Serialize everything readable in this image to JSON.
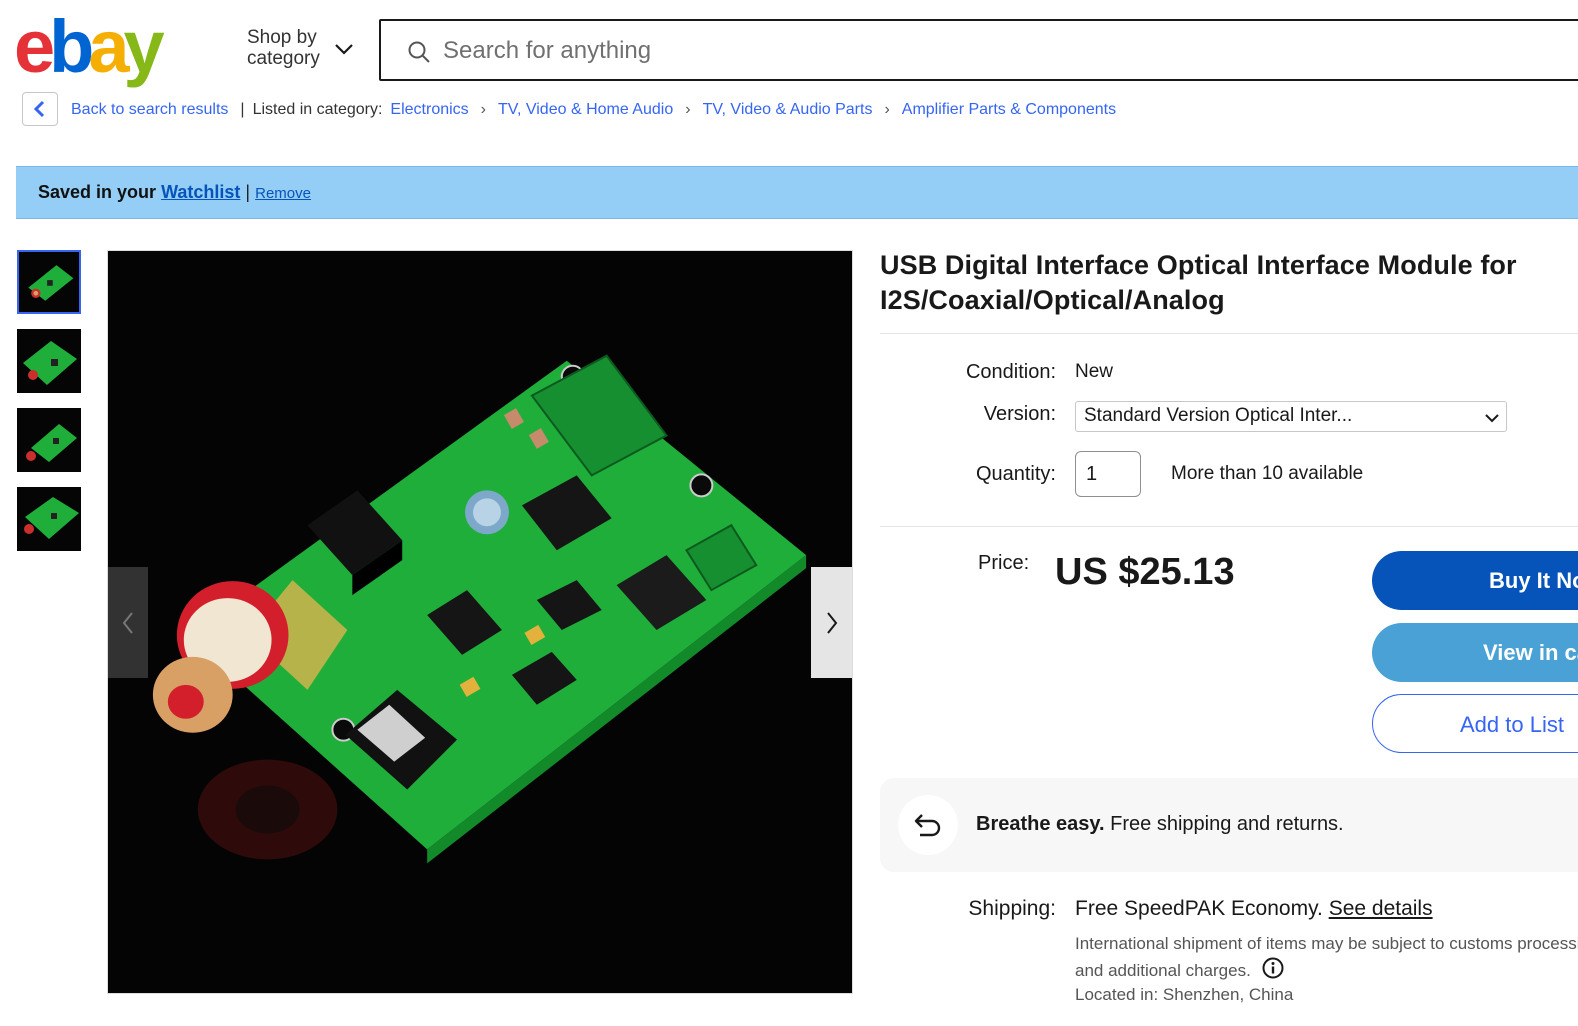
{
  "header": {
    "logo_text": "ebay",
    "shop_by_line1": "Shop by",
    "shop_by_line2": "category",
    "search_placeholder": "Search for anything"
  },
  "breadcrumb": {
    "back_label": "Back to search results",
    "listed_label": "Listed in category:",
    "items": [
      "Electronics",
      "TV, Video & Home Audio",
      "TV, Video & Audio Parts",
      "Amplifier Parts & Components"
    ]
  },
  "watchlist_banner": {
    "prefix": "Saved in your",
    "watchlist_link": "Watchlist",
    "separator": "|",
    "remove_link": "Remove"
  },
  "gallery": {
    "thumbnail_count": 4,
    "selected_index": 0
  },
  "product": {
    "title": "USB Digital Interface Optical Interface Module for I2S/Coaxial/Optical/Analog",
    "condition_label": "Condition:",
    "condition_value": "New",
    "version_label": "Version:",
    "version_value": "Standard Version Optical Inter...",
    "quantity_label": "Quantity:",
    "quantity_value": "1",
    "availability": "More than 10 available",
    "price_label": "Price:",
    "price_value": "US $25.13"
  },
  "actions": {
    "buy_now": "Buy It Now",
    "add_to_cart": "View in cart",
    "add_to_list": "Add to List"
  },
  "promo": {
    "bold": "Breathe easy.",
    "text": " Free shipping and returns."
  },
  "shipping": {
    "label": "Shipping:",
    "main": "Free SpeedPAK Economy. ",
    "see_details": "See details",
    "note_line1": "International shipment of items may be subject to customs processing",
    "note_line2": "and additional charges.",
    "located": "Located in: Shenzhen, China"
  },
  "colors": {
    "ebay_red": "#e53238",
    "ebay_blue": "#0064d2",
    "ebay_yellow": "#f5af02",
    "ebay_green": "#86b817",
    "link_blue": "#3665f3",
    "banner_bg": "#94cef6",
    "buy_btn": "#0654ba",
    "cart_btn": "#4aa1d5",
    "pcb_green": "#1fae3a"
  },
  "icons": [
    "search-icon",
    "chevron-down-icon",
    "chevron-left-icon",
    "chevron-right-icon",
    "return-icon",
    "info-icon"
  ]
}
